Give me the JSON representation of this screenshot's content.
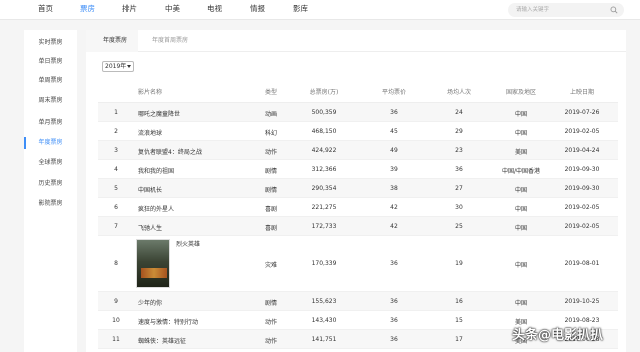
{
  "nav": {
    "items": [
      "首页",
      "票房",
      "排片",
      "中美",
      "电视",
      "情报",
      "影库"
    ],
    "active_index": 1,
    "search_placeholder": "请输入关键字"
  },
  "sidebar": {
    "items": [
      "实时票房",
      "单日票房",
      "单周票房",
      "周末票房",
      "单月票房",
      "年度票房",
      "全球票房",
      "历史票房",
      "影院票房"
    ],
    "active_index": 5
  },
  "tabs": [
    "年度票房",
    "年度首周票房"
  ],
  "year_select": "2019年",
  "table": {
    "headers": [
      "",
      "影片名称",
      "类型",
      "总票房(万)",
      "平均票价",
      "场均人次",
      "国家及地区",
      "上映日期"
    ],
    "rows": [
      {
        "rank": "1",
        "title": "哪吒之魔童降世",
        "type": "动画",
        "total": "500,359",
        "price": "36",
        "people": "24",
        "region": "中国",
        "date": "2019-07-26"
      },
      {
        "rank": "2",
        "title": "流浪地球",
        "type": "科幻",
        "total": "468,150",
        "price": "45",
        "people": "29",
        "region": "中国",
        "date": "2019-02-05"
      },
      {
        "rank": "3",
        "title": "复仇者联盟4：终局之战",
        "type": "动作",
        "total": "424,922",
        "price": "49",
        "people": "23",
        "region": "美国",
        "date": "2019-04-24"
      },
      {
        "rank": "4",
        "title": "我和我的祖国",
        "type": "剧情",
        "total": "312,366",
        "price": "39",
        "people": "36",
        "region": "中国/中国香港",
        "date": "2019-09-30"
      },
      {
        "rank": "5",
        "title": "中国机长",
        "type": "剧情",
        "total": "290,354",
        "price": "38",
        "people": "27",
        "region": "中国",
        "date": "2019-09-30"
      },
      {
        "rank": "6",
        "title": "疯狂的外星人",
        "type": "喜剧",
        "total": "221,275",
        "price": "42",
        "people": "30",
        "region": "中国",
        "date": "2019-02-05"
      },
      {
        "rank": "7",
        "title": "飞驰人生",
        "type": "喜剧",
        "total": "172,733",
        "price": "42",
        "people": "25",
        "region": "中国",
        "date": "2019-02-05"
      },
      {
        "rank": "8",
        "title": "烈火英雄",
        "type": "灾难",
        "total": "170,339",
        "price": "36",
        "people": "19",
        "region": "中国",
        "date": "2019-08-01"
      },
      {
        "rank": "9",
        "title": "少年的你",
        "type": "剧情",
        "total": "155,623",
        "price": "36",
        "people": "16",
        "region": "中国",
        "date": "2019-10-25"
      },
      {
        "rank": "10",
        "title": "速度与激情：特别行动",
        "type": "动作",
        "total": "143,430",
        "price": "36",
        "people": "15",
        "region": "美国",
        "date": "2019-08-23"
      },
      {
        "rank": "11",
        "title": "蜘蛛侠：英雄远征",
        "type": "动作",
        "total": "141,751",
        "price": "36",
        "people": "17",
        "region": "美国",
        "date": "2019-06-28"
      }
    ]
  },
  "watermark": "头条@电影扒扒"
}
